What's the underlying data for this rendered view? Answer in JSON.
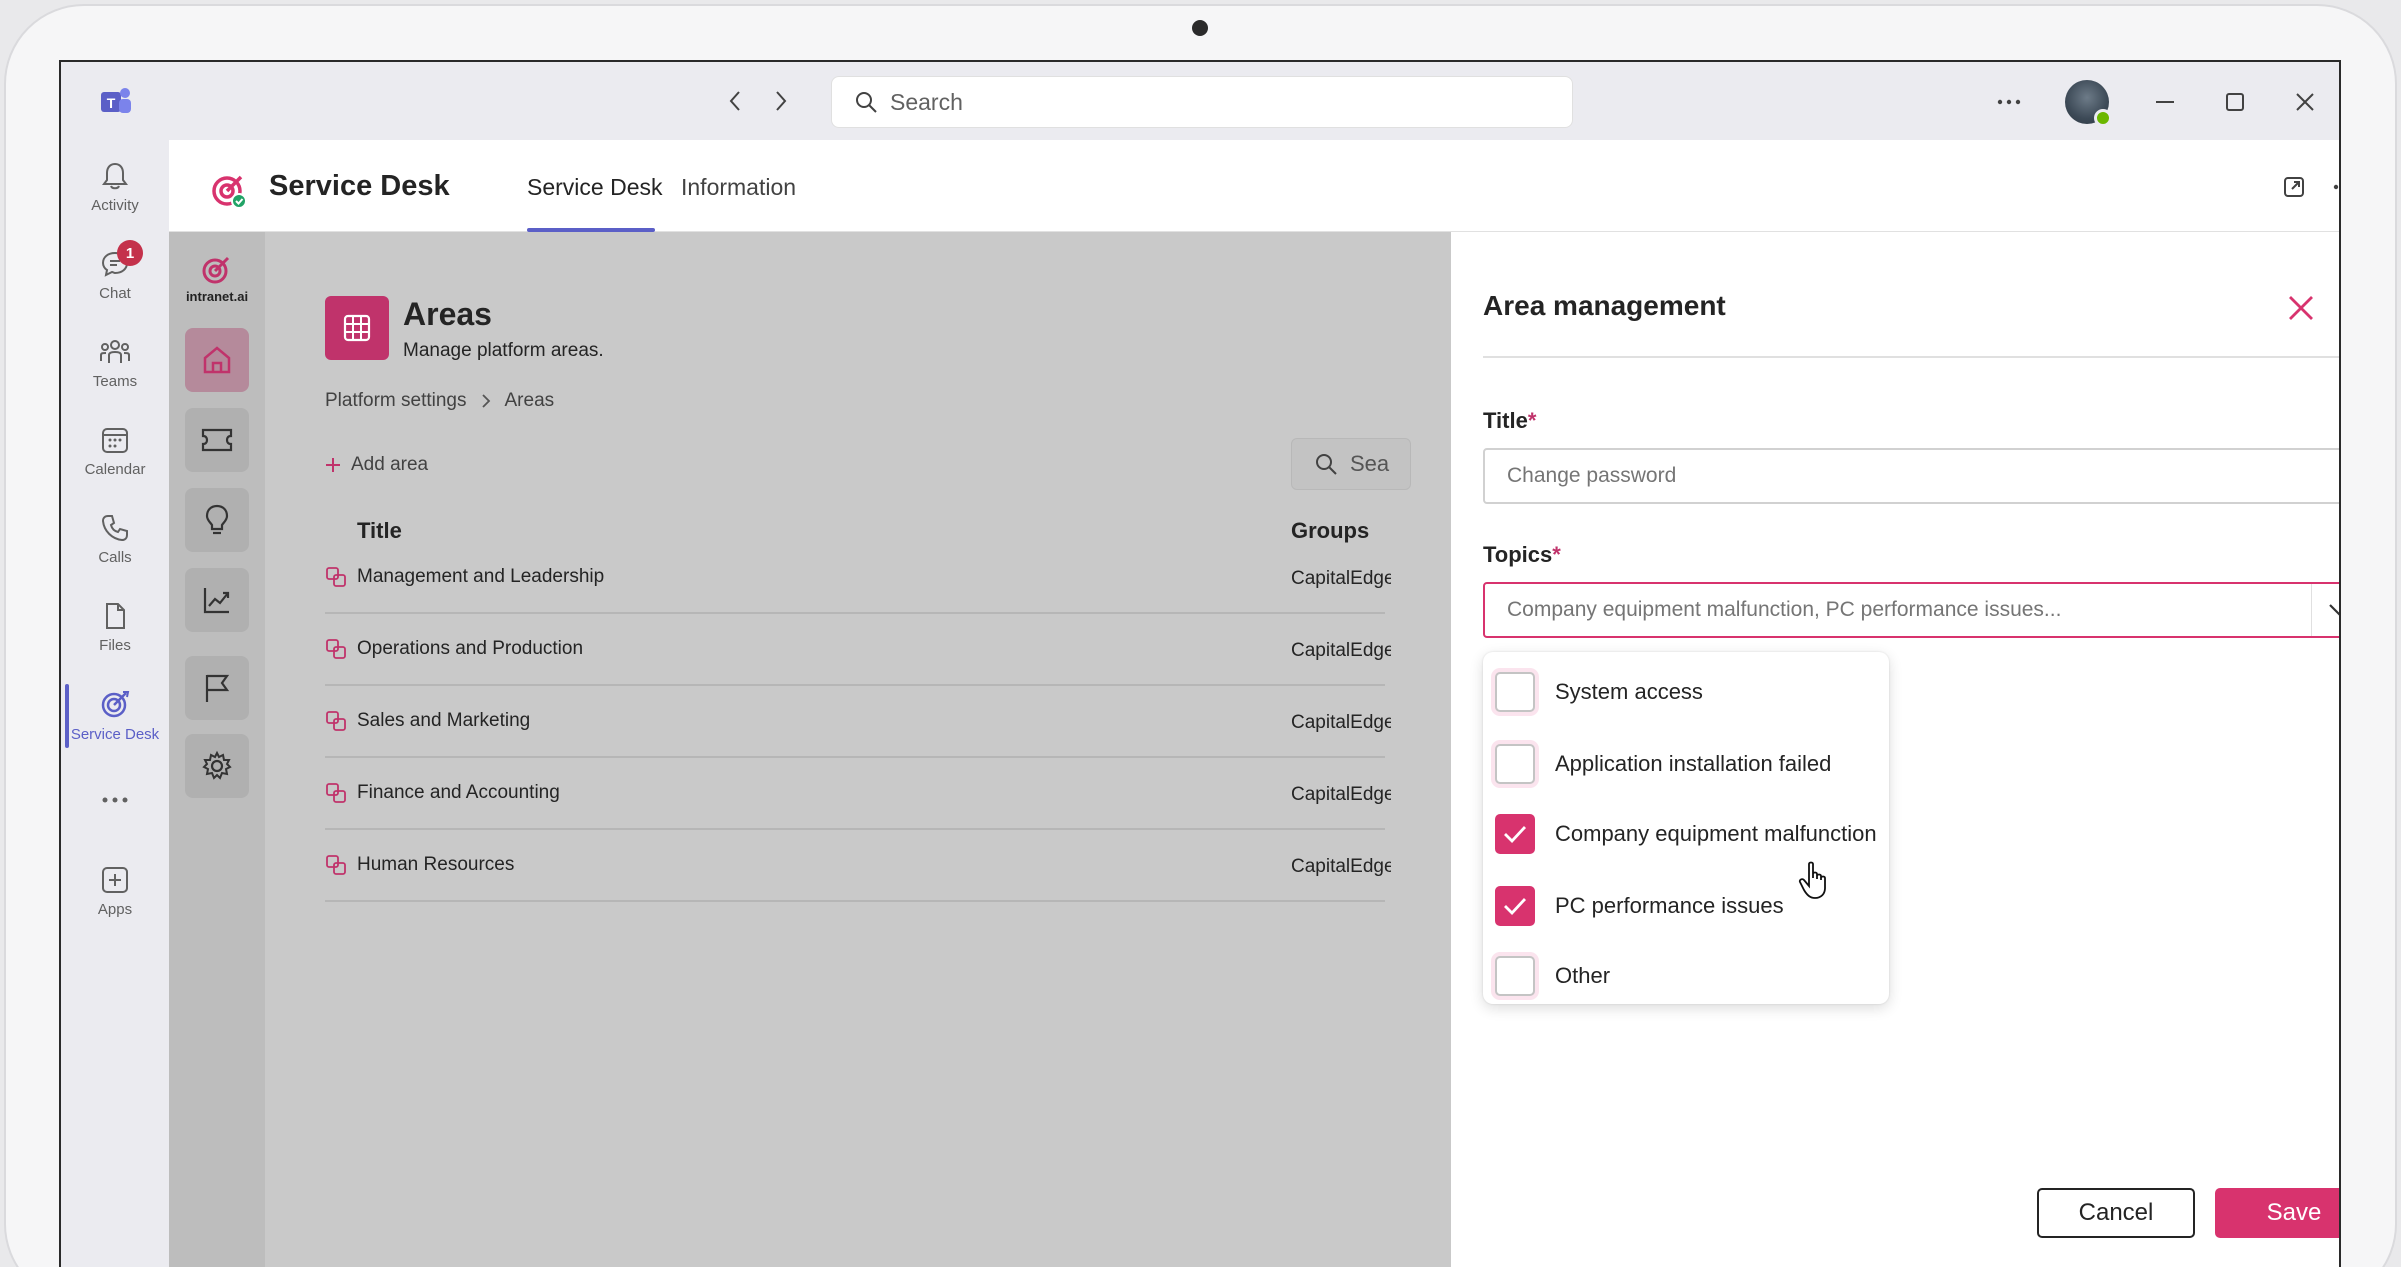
{
  "titlebar": {
    "search_placeholder": "Search"
  },
  "rail": {
    "items": [
      {
        "label": "Activity",
        "icon": "bell-icon"
      },
      {
        "label": "Chat",
        "icon": "chat-icon",
        "badge": "1"
      },
      {
        "label": "Teams",
        "icon": "teams-icon"
      },
      {
        "label": "Calendar",
        "icon": "calendar-icon"
      },
      {
        "label": "Calls",
        "icon": "phone-icon"
      },
      {
        "label": "Files",
        "icon": "file-icon"
      },
      {
        "label": "Service Desk",
        "icon": "service-desk-icon"
      },
      {
        "label": "...",
        "icon": "more-icon"
      },
      {
        "label": "Apps",
        "icon": "add-apps-icon"
      }
    ]
  },
  "app_header": {
    "title": "Service Desk",
    "tabs": [
      {
        "label": "Service Desk"
      },
      {
        "label": "Information"
      }
    ]
  },
  "side2": {
    "logo_text": "intranet.ai"
  },
  "areas": {
    "title": "Areas",
    "subtitle": "Manage platform areas.",
    "breadcrumb": [
      "Platform settings",
      "Areas"
    ],
    "add_label": "Add area",
    "search_placeholder": "Sea",
    "columns": [
      "Title",
      "Groups"
    ],
    "rows": [
      {
        "title": "Management and Leadership",
        "groups": "CapitalEdge"
      },
      {
        "title": "Operations and Production",
        "groups": "CapitalEdge"
      },
      {
        "title": "Sales and Marketing",
        "groups": "CapitalEdge"
      },
      {
        "title": "Finance and Accounting",
        "groups": "CapitalEdge"
      },
      {
        "title": "Human Resources",
        "groups": "CapitalEdge"
      }
    ]
  },
  "panel": {
    "title": "Area management",
    "title_label": "Title",
    "required_mark": "*",
    "title_placeholder": "Change password",
    "topics_label": "Topics",
    "topics_value": "Company equipment malfunction, PC performance issues...",
    "options": [
      {
        "label": "System access",
        "checked": false
      },
      {
        "label": "Application installation failed",
        "checked": false
      },
      {
        "label": "Company equipment malfunction",
        "checked": true
      },
      {
        "label": "PC performance issues",
        "checked": true
      },
      {
        "label": "Other",
        "checked": false
      }
    ],
    "cancel_label": "Cancel",
    "save_label": "Save"
  },
  "colors": {
    "accent": "#d8336e",
    "teams_purple": "#5b5fc7"
  }
}
